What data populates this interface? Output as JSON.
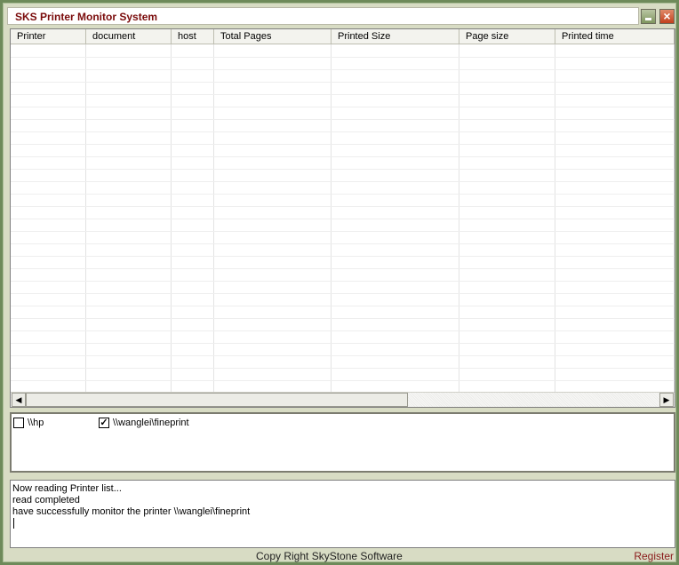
{
  "window": {
    "title": "SKS Printer Monitor System",
    "minimize_glyph": "_",
    "close_glyph": "×"
  },
  "table": {
    "columns": [
      "Printer",
      "document",
      "host",
      "Total Pages",
      "Printed Size",
      "Page size",
      "Printed time"
    ],
    "rows": []
  },
  "scrollbar": {
    "left_arrow": "◀",
    "right_arrow": "▶"
  },
  "printers": [
    {
      "label": "\\\\hp",
      "checked": false
    },
    {
      "label": "\\\\wanglei\\fineprint",
      "checked": true
    }
  ],
  "log": {
    "lines": [
      "Now reading Printer list...",
      "read completed",
      "have successfully monitor the printer \\\\wanglei\\fineprint"
    ]
  },
  "status": {
    "copyright": "Copy Right SkyStone Software",
    "register": "Register"
  },
  "colors": {
    "title_text": "#7a0b0b",
    "frame": "#6e8a5a",
    "register_text": "#8a1a1a"
  }
}
